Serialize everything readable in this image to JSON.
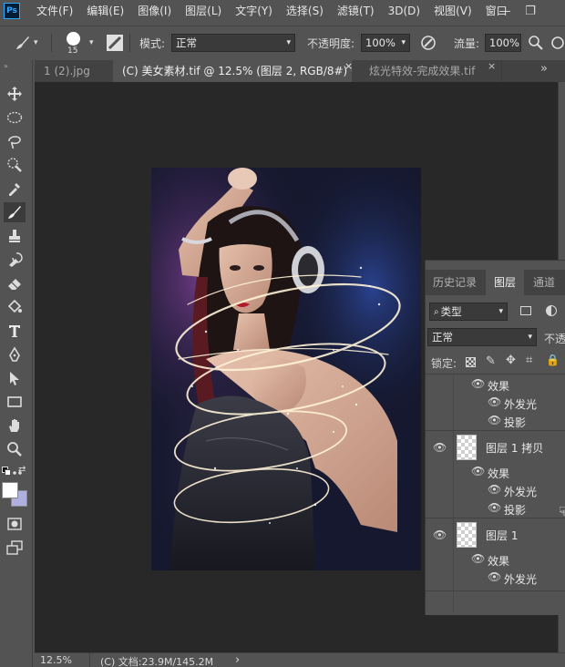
{
  "app": {
    "logo": "Ps"
  },
  "menu": [
    "文件(F)",
    "编辑(E)",
    "图像(I)",
    "图层(L)",
    "文字(Y)",
    "选择(S)",
    "滤镜(T)",
    "3D(D)",
    "视图(V)",
    "窗口"
  ],
  "window_controls": {
    "minimize": "—",
    "restore": "❐"
  },
  "options": {
    "brush_size": "15",
    "mode_label": "模式:",
    "mode_value": "正常",
    "opacity_label": "不透明度:",
    "opacity_value": "100%",
    "flow_label": "流量:",
    "flow_value": "100%"
  },
  "tabs": [
    {
      "label": "1 (2).jpg",
      "close": "×"
    },
    {
      "label": "(C) 美女素材.tif @ 12.5% (图层 2, RGB/8#) *",
      "close": "×"
    },
    {
      "label": "炫光特效-完成效果.tif",
      "close": "×"
    }
  ],
  "tab_overflow": "»",
  "status": {
    "zoom": "12.5%",
    "doc": "(C) 文档:23.9M/145.2M",
    "arrow": "›"
  },
  "layers_panel": {
    "tabs": [
      "历史记录",
      "图层",
      "通道"
    ],
    "filter_label": "类型",
    "blend_mode": "正常",
    "opacity_short": "不透",
    "lock_label": "锁定:",
    "rows": [
      {
        "kind": "effect",
        "label": "效果"
      },
      {
        "kind": "fx",
        "label": "外发光"
      },
      {
        "kind": "fx",
        "label": "投影"
      },
      {
        "kind": "layer",
        "label": "图层 1 拷贝"
      },
      {
        "kind": "effect",
        "label": "效果"
      },
      {
        "kind": "fx",
        "label": "外发光"
      },
      {
        "kind": "fx",
        "label": "投影"
      },
      {
        "kind": "layer",
        "label": "图层 1"
      },
      {
        "kind": "effect",
        "label": "效果"
      },
      {
        "kind": "fx",
        "label": "外发光"
      }
    ]
  },
  "colors": {
    "ui_bg": "#535353",
    "canvas_bg": "#282828",
    "accent": "#31a8ff"
  }
}
